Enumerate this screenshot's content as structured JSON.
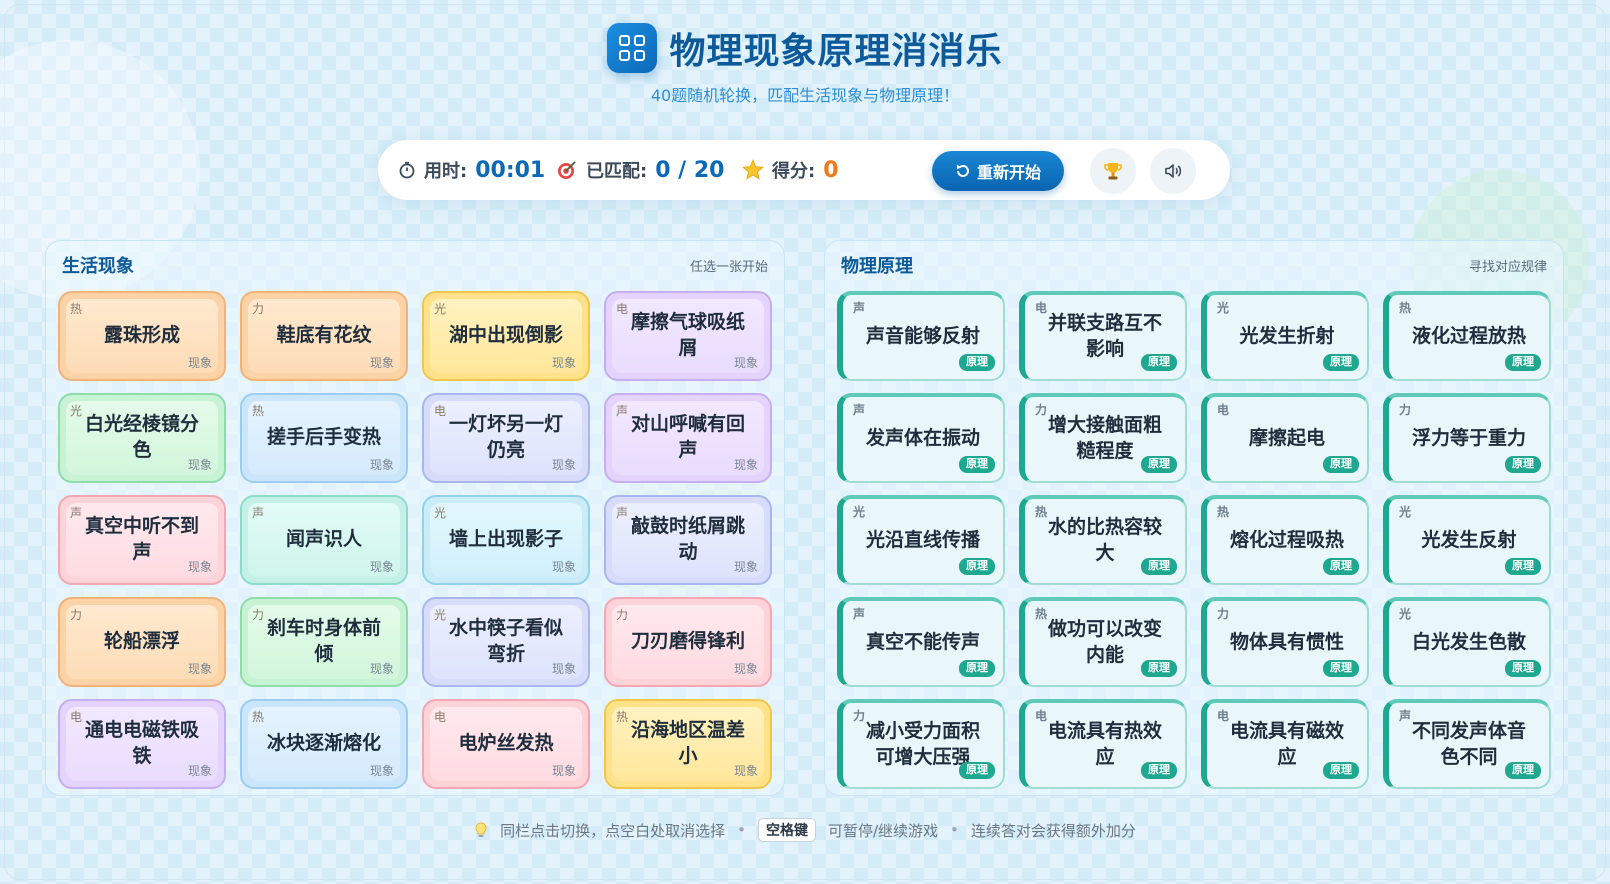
{
  "header": {
    "title": "物理现象原理消消乐",
    "subtitle": "40题随机轮换，匹配生活现象与物理原理！"
  },
  "stats": {
    "time_label": "用时:",
    "time_value": "00:01",
    "matched_label": "已匹配:",
    "matched_value": "0 / 20",
    "score_label": "得分:",
    "score_value": "0",
    "restart_label": "重新开始"
  },
  "left_panel": {
    "title": "生活现象",
    "hint": "任选一张开始",
    "tag": "现象",
    "cards": [
      {
        "cat": "热",
        "text": "露珠形成",
        "color": "#fcd3a7"
      },
      {
        "cat": "力",
        "text": "鞋底有花纹",
        "color": "#fcd3a7"
      },
      {
        "cat": "光",
        "text": "湖中出现倒影",
        "color": "#fde28a"
      },
      {
        "cat": "电",
        "text": "摩擦气球吸纸屑",
        "color": "#e4d4fb"
      },
      {
        "cat": "光",
        "text": "白光经棱镜分色",
        "color": "#c8f2d4"
      },
      {
        "cat": "热",
        "text": "搓手后手变热",
        "color": "#cbe6fb"
      },
      {
        "cat": "电",
        "text": "一灯坏另一灯仍亮",
        "color": "#d6dcfa"
      },
      {
        "cat": "声",
        "text": "对山呼喊有回声",
        "color": "#e4d4fb"
      },
      {
        "cat": "声",
        "text": "真空中听不到声",
        "color": "#fdd3da"
      },
      {
        "cat": "声",
        "text": "闻声识人",
        "color": "#c4f0e8"
      },
      {
        "cat": "光",
        "text": "墙上出现影子",
        "color": "#c9ecf7"
      },
      {
        "cat": "声",
        "text": "敲鼓时纸屑跳动",
        "color": "#d6dcfa"
      },
      {
        "cat": "力",
        "text": "轮船漂浮",
        "color": "#fcd3a7"
      },
      {
        "cat": "力",
        "text": "刹车时身体前倾",
        "color": "#c8f2d4"
      },
      {
        "cat": "光",
        "text": "水中筷子看似弯折",
        "color": "#d6dcfa"
      },
      {
        "cat": "力",
        "text": "刀刃磨得锋利",
        "color": "#fdd3da"
      },
      {
        "cat": "电",
        "text": "通电电磁铁吸铁",
        "color": "#e4d4fb"
      },
      {
        "cat": "热",
        "text": "冰块逐渐熔化",
        "color": "#cbe6fb"
      },
      {
        "cat": "电",
        "text": "电炉丝发热",
        "color": "#fdd3da"
      },
      {
        "cat": "热",
        "text": "沿海地区温差小",
        "color": "#fde28a"
      }
    ]
  },
  "right_panel": {
    "title": "物理原理",
    "hint": "寻找对应规律",
    "tag": "原理",
    "cards": [
      {
        "cat": "声",
        "text": "声音能够反射"
      },
      {
        "cat": "电",
        "text": "并联支路互不影响"
      },
      {
        "cat": "光",
        "text": "光发生折射"
      },
      {
        "cat": "热",
        "text": "液化过程放热"
      },
      {
        "cat": "声",
        "text": "发声体在振动"
      },
      {
        "cat": "力",
        "text": "增大接触面粗糙程度"
      },
      {
        "cat": "电",
        "text": "摩擦起电"
      },
      {
        "cat": "力",
        "text": "浮力等于重力"
      },
      {
        "cat": "光",
        "text": "光沿直线传播"
      },
      {
        "cat": "热",
        "text": "水的比热容较大"
      },
      {
        "cat": "热",
        "text": "熔化过程吸热"
      },
      {
        "cat": "光",
        "text": "光发生反射"
      },
      {
        "cat": "声",
        "text": "真空不能传声"
      },
      {
        "cat": "热",
        "text": "做功可以改变内能"
      },
      {
        "cat": "力",
        "text": "物体具有惯性"
      },
      {
        "cat": "光",
        "text": "白光发生色散"
      },
      {
        "cat": "力",
        "text": "减小受力面积可增大压强"
      },
      {
        "cat": "电",
        "text": "电流具有热效应"
      },
      {
        "cat": "电",
        "text": "电流具有磁效应"
      },
      {
        "cat": "声",
        "text": "不同发声体音色不同"
      }
    ]
  },
  "footer": {
    "tip1": "同栏点击切换，点空白处取消选择",
    "key": "空格键",
    "tip2": "可暂停/继续游戏",
    "tip3": "连续答对会获得额外加分",
    "separator": "•"
  }
}
